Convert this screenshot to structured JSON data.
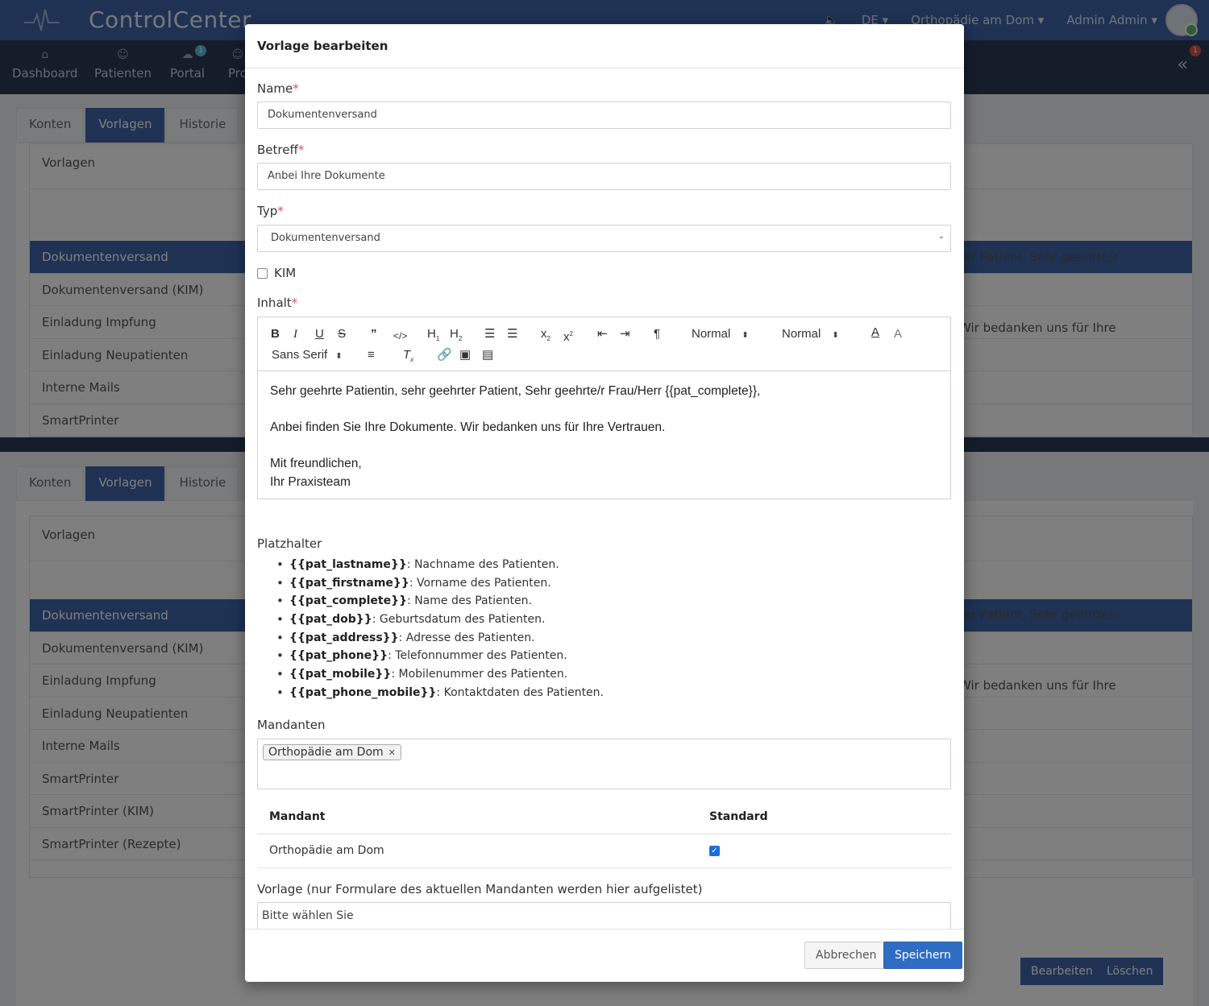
{
  "header": {
    "brand_main": "Control",
    "brand_second": "Center",
    "language": "DE ▾",
    "tenant": "Orthopädie am Dom ▾",
    "user": "Admin Admin ▾"
  },
  "nav": {
    "items": [
      {
        "label": "Dashboard",
        "icon": "home-icon"
      },
      {
        "label": "Patienten",
        "icon": "user-icon"
      },
      {
        "label": "Portal",
        "icon": "cloud-icon",
        "badge": "1"
      },
      {
        "label": "Pro",
        "icon": "person-icon"
      }
    ],
    "notification_badge": "1"
  },
  "background": {
    "tabs": [
      "Konten",
      "Vorlagen",
      "Historie"
    ],
    "card_title": "Vorlagen",
    "list_top": [
      "Dokumentenversand",
      "Dokumentenversand (KIM)",
      "Einladung Impfung",
      "Einladung Neupatienten",
      "Interne Mails",
      "SmartPrinter"
    ],
    "list_bottom": [
      "Dokumentenversand",
      "Dokumentenversand (KIM)",
      "Einladung Impfung",
      "Einladung Neupatienten",
      "Interne Mails",
      "SmartPrinter",
      "SmartPrinter (KIM)",
      "SmartPrinter (Rezepte)"
    ],
    "preview_line1": "ter Patient, Sehr geehrte/r",
    "preview_line2": "Wir bedanken uns für Ihre",
    "edit_button": "Bearbeiten",
    "delete_button": "Löschen"
  },
  "modal": {
    "title": "Vorlage bearbeiten",
    "name_label": "Name",
    "name_value": "Dokumentenversand",
    "subject_label": "Betreff",
    "subject_value": "Anbei Ihre Dokumente",
    "type_label": "Typ",
    "type_value": "Dokumentenversand",
    "kim_label": "KIM",
    "content_label": "Inhalt",
    "toolbar": {
      "header_select": "Normal",
      "size_select": "Normal",
      "font_select": "Sans Serif"
    },
    "content": {
      "line1": "Sehr geehrte Patientin, sehr geehrter Patient, Sehr geehrte/r Frau/Herr {{pat_complete}},",
      "line2": "Anbei finden Sie Ihre Dokumente. Wir bedanken uns für Ihre Vertrauen.",
      "line3": "Mit freundlichen,",
      "line4": "Ihr Praxisteam"
    },
    "placeholders_label": "Platzhalter",
    "placeholders": [
      {
        "key": "{{pat_lastname}}",
        "desc": ": Nachname des Patienten."
      },
      {
        "key": "{{pat_firstname}}",
        "desc": ": Vorname des Patienten."
      },
      {
        "key": "{{pat_complete}}",
        "desc": ": Name des Patienten."
      },
      {
        "key": "{{pat_dob}}",
        "desc": ": Geburtsdatum des Patienten."
      },
      {
        "key": "{{pat_address}}",
        "desc": ": Adresse des Patienten."
      },
      {
        "key": "{{pat_phone}}",
        "desc": ": Telefonnummer des Patienten."
      },
      {
        "key": "{{pat_mobile}}",
        "desc": ": Mobilenummer des Patienten."
      },
      {
        "key": "{{pat_phone_mobile}}",
        "desc": ": Kontaktdaten des Patienten."
      }
    ],
    "tenants_label": "Mandanten",
    "tenant_tag": "Orthopädie am Dom",
    "table": {
      "col_tenant": "Mandant",
      "col_default": "Standard",
      "row_tenant": "Orthopädie am Dom"
    },
    "template_label": "Vorlage (nur Formulare des aktuellen Mandanten werden hier aufgelistet)",
    "template_placeholder": "Bitte wählen Sie",
    "cancel_button": "Abbrechen",
    "save_button": "Speichern"
  },
  "colors": {
    "primary": "#3f64a8",
    "navbar": "#2b3b56",
    "save_button": "#2f6dc4",
    "required": "#d9534f"
  }
}
